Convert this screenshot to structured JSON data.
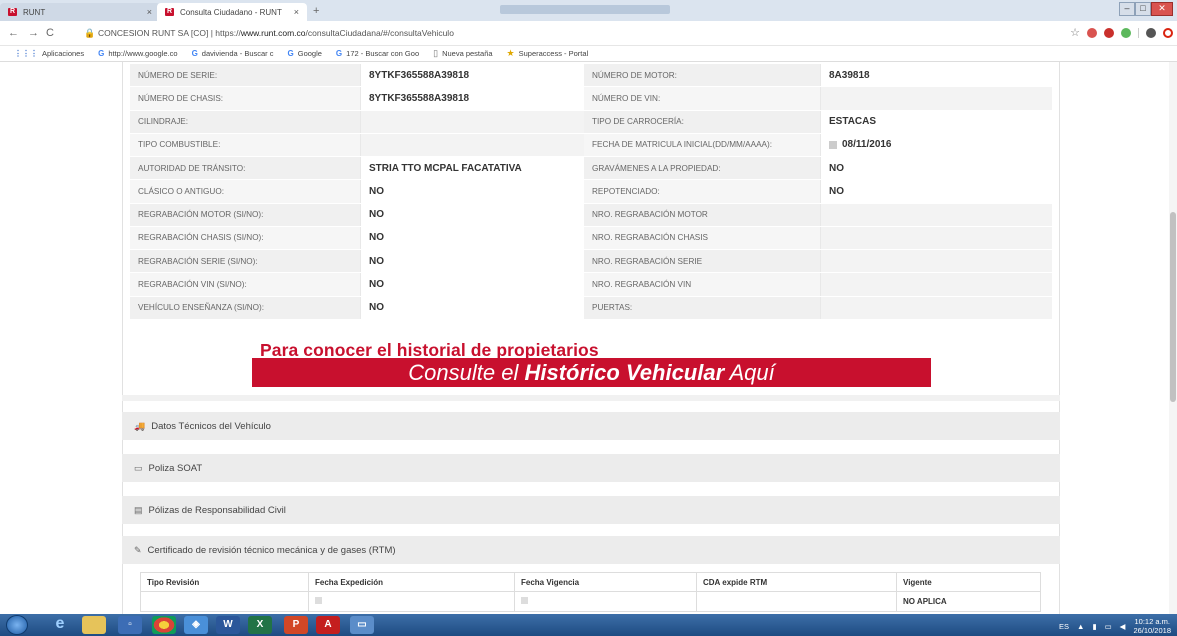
{
  "browser": {
    "tabs": [
      {
        "label": "RUNT",
        "close": "×"
      },
      {
        "label": "Consulta Ciudadano - RUNT",
        "close": "×"
      }
    ],
    "new_tab": "+",
    "url_prefix": "CONCESION RUNT SA [CO] | https://",
    "url_host": "www.runt.com.co",
    "url_path": "/consultaCiudadana/#/consultaVehiculo",
    "bookmarks": [
      {
        "label": "Aplicaciones",
        "icon": "apps-icon"
      },
      {
        "label": "http://www.google.co",
        "icon": "G"
      },
      {
        "label": "davivienda - Buscar c",
        "icon": "G"
      },
      {
        "label": "Google",
        "icon": "G"
      },
      {
        "label": "172 - Buscar con Goo",
        "icon": "G"
      },
      {
        "label": "Nueva pestaña",
        "icon": "page-icon"
      },
      {
        "label": "Superaccess - Portal",
        "icon": "portal-icon"
      }
    ]
  },
  "vehicle_fields": [
    {
      "l1": "NÚMERO DE SERIE:",
      "v1": "8YTKF365588A39818",
      "l2": "NÚMERO DE MOTOR:",
      "v2": "8A39818"
    },
    {
      "l1": "NÚMERO DE CHASIS:",
      "v1": "8YTKF365588A39818",
      "l2": "NÚMERO DE VIN:",
      "v2": ""
    },
    {
      "l1": "CILINDRAJE:",
      "v1": "",
      "l2": "TIPO DE CARROCERÍA:",
      "v2": "ESTACAS"
    },
    {
      "l1": "TIPO COMBUSTIBLE:",
      "v1": "",
      "l2": "FECHA DE MATRICULA INICIAL(DD/MM/AAAA):",
      "v2": "08/11/2016"
    },
    {
      "l1": "AUTORIDAD DE TRÁNSITO:",
      "v1": "STRIA TTO MCPAL FACATATIVA",
      "l2": "GRAVÁMENES A LA PROPIEDAD:",
      "v2": "NO"
    },
    {
      "l1": "CLÁSICO O ANTIGUO:",
      "v1": "NO",
      "l2": "REPOTENCIADO:",
      "v2": "NO"
    },
    {
      "l1": "REGRABACIÓN MOTOR (SI/NO):",
      "v1": "NO",
      "l2": "NRO. REGRABACIÓN MOTOR",
      "v2": ""
    },
    {
      "l1": "REGRABACIÓN CHASIS (SI/NO):",
      "v1": "NO",
      "l2": "NRO. REGRABACIÓN CHASIS",
      "v2": ""
    },
    {
      "l1": "REGRABACIÓN SERIE (SI/NO):",
      "v1": "NO",
      "l2": "NRO. REGRABACIÓN SERIE",
      "v2": ""
    },
    {
      "l1": "REGRABACIÓN VIN (SI/NO):",
      "v1": "NO",
      "l2": "NRO. REGRABACIÓN VIN",
      "v2": ""
    },
    {
      "l1": "VEHÍCULO ENSEÑANZA (SI/NO):",
      "v1": "NO",
      "l2": "PUERTAS:",
      "v2": ""
    }
  ],
  "historico": {
    "line1": "Para conocer el historial de propietarios",
    "line2_pre": "Consulte el ",
    "line2_bold": "Histórico Vehicular",
    "line2_post": " Aquí"
  },
  "sections": [
    {
      "label": "Datos Técnicos del Vehículo",
      "icon": "car-icon"
    },
    {
      "label": "Poliza SOAT",
      "icon": "card-icon"
    },
    {
      "label": "Pólizas de Responsabilidad Civil",
      "icon": "document-icon"
    },
    {
      "label": "Certificado de revisión técnico mecánica y de gases (RTM)",
      "icon": "wrench-icon"
    }
  ],
  "rtm_table": {
    "headers": [
      "Tipo Revisión",
      "Fecha Expedición",
      "Fecha Vigencia",
      "CDA expide RTM",
      "Vigente"
    ],
    "row": [
      "",
      "",
      "",
      "",
      "NO APLICA"
    ]
  },
  "taskbar": {
    "lang": "ES",
    "time": "10:12 a.m.",
    "date": "26/10/2018"
  }
}
